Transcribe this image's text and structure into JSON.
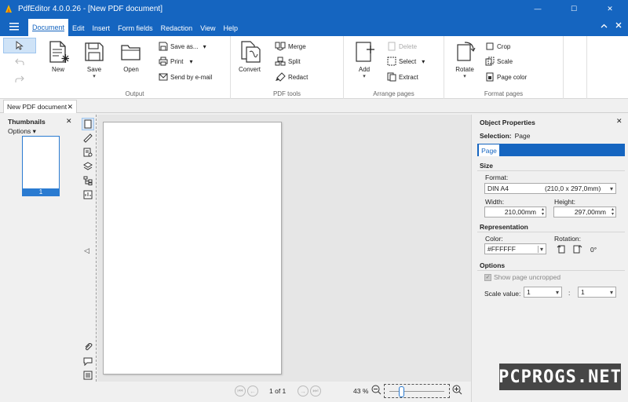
{
  "window": {
    "title": "PdfEditor 4.0.0.26 - [New PDF document]",
    "minimize": "—",
    "maximize": "☐",
    "close": "✕"
  },
  "menu": [
    "Document",
    "Edit",
    "Insert",
    "Form fields",
    "Redaction",
    "View",
    "Help"
  ],
  "menu_active": "Document",
  "ribbon": {
    "new": "New",
    "save": "Save",
    "open": "Open",
    "save_as": "Save as...",
    "print": "Print",
    "send_email": "Send by e-mail",
    "group_output": "Output",
    "convert": "Convert",
    "merge": "Merge",
    "split": "Split",
    "redact": "Redact",
    "group_pdf_tools": "PDF tools",
    "add": "Add",
    "delete": "Delete",
    "select": "Select",
    "extract": "Extract",
    "group_arrange": "Arrange pages",
    "rotate": "Rotate",
    "crop": "Crop",
    "scale": "Scale",
    "page_color": "Page color",
    "group_format": "Format pages"
  },
  "doc_tab": "New PDF document",
  "thumbnails": {
    "header": "Thumbnails",
    "options": "Options ▾",
    "page_number": "1"
  },
  "status": {
    "page_count": "1 of 1",
    "zoom": "43 %"
  },
  "props": {
    "title": "Object Properties",
    "selection_label": "Selection:",
    "selection_value": "Page",
    "tab": "Page",
    "size_section": "Size",
    "format_label": "Format:",
    "format_value": "DIN A4",
    "format_dims": "(210,0 x 297,0mm)",
    "width_label": "Width:",
    "width_value": "210,00mm",
    "height_label": "Height:",
    "height_value": "297,00mm",
    "representation_section": "Representation",
    "color_label": "Color:",
    "color_value": "#FFFFFF",
    "rotation_label": "Rotation:",
    "rotation_value": "0°",
    "options_section": "Options",
    "show_uncropped": "Show page uncropped",
    "scale_label": "Scale value:",
    "scale_a": "1",
    "scale_sep": ":",
    "scale_b": "1"
  },
  "watermark": "PCPROGS.NET",
  "colors": {
    "accent": "#1565c0",
    "selection": "#2a7bd1"
  }
}
